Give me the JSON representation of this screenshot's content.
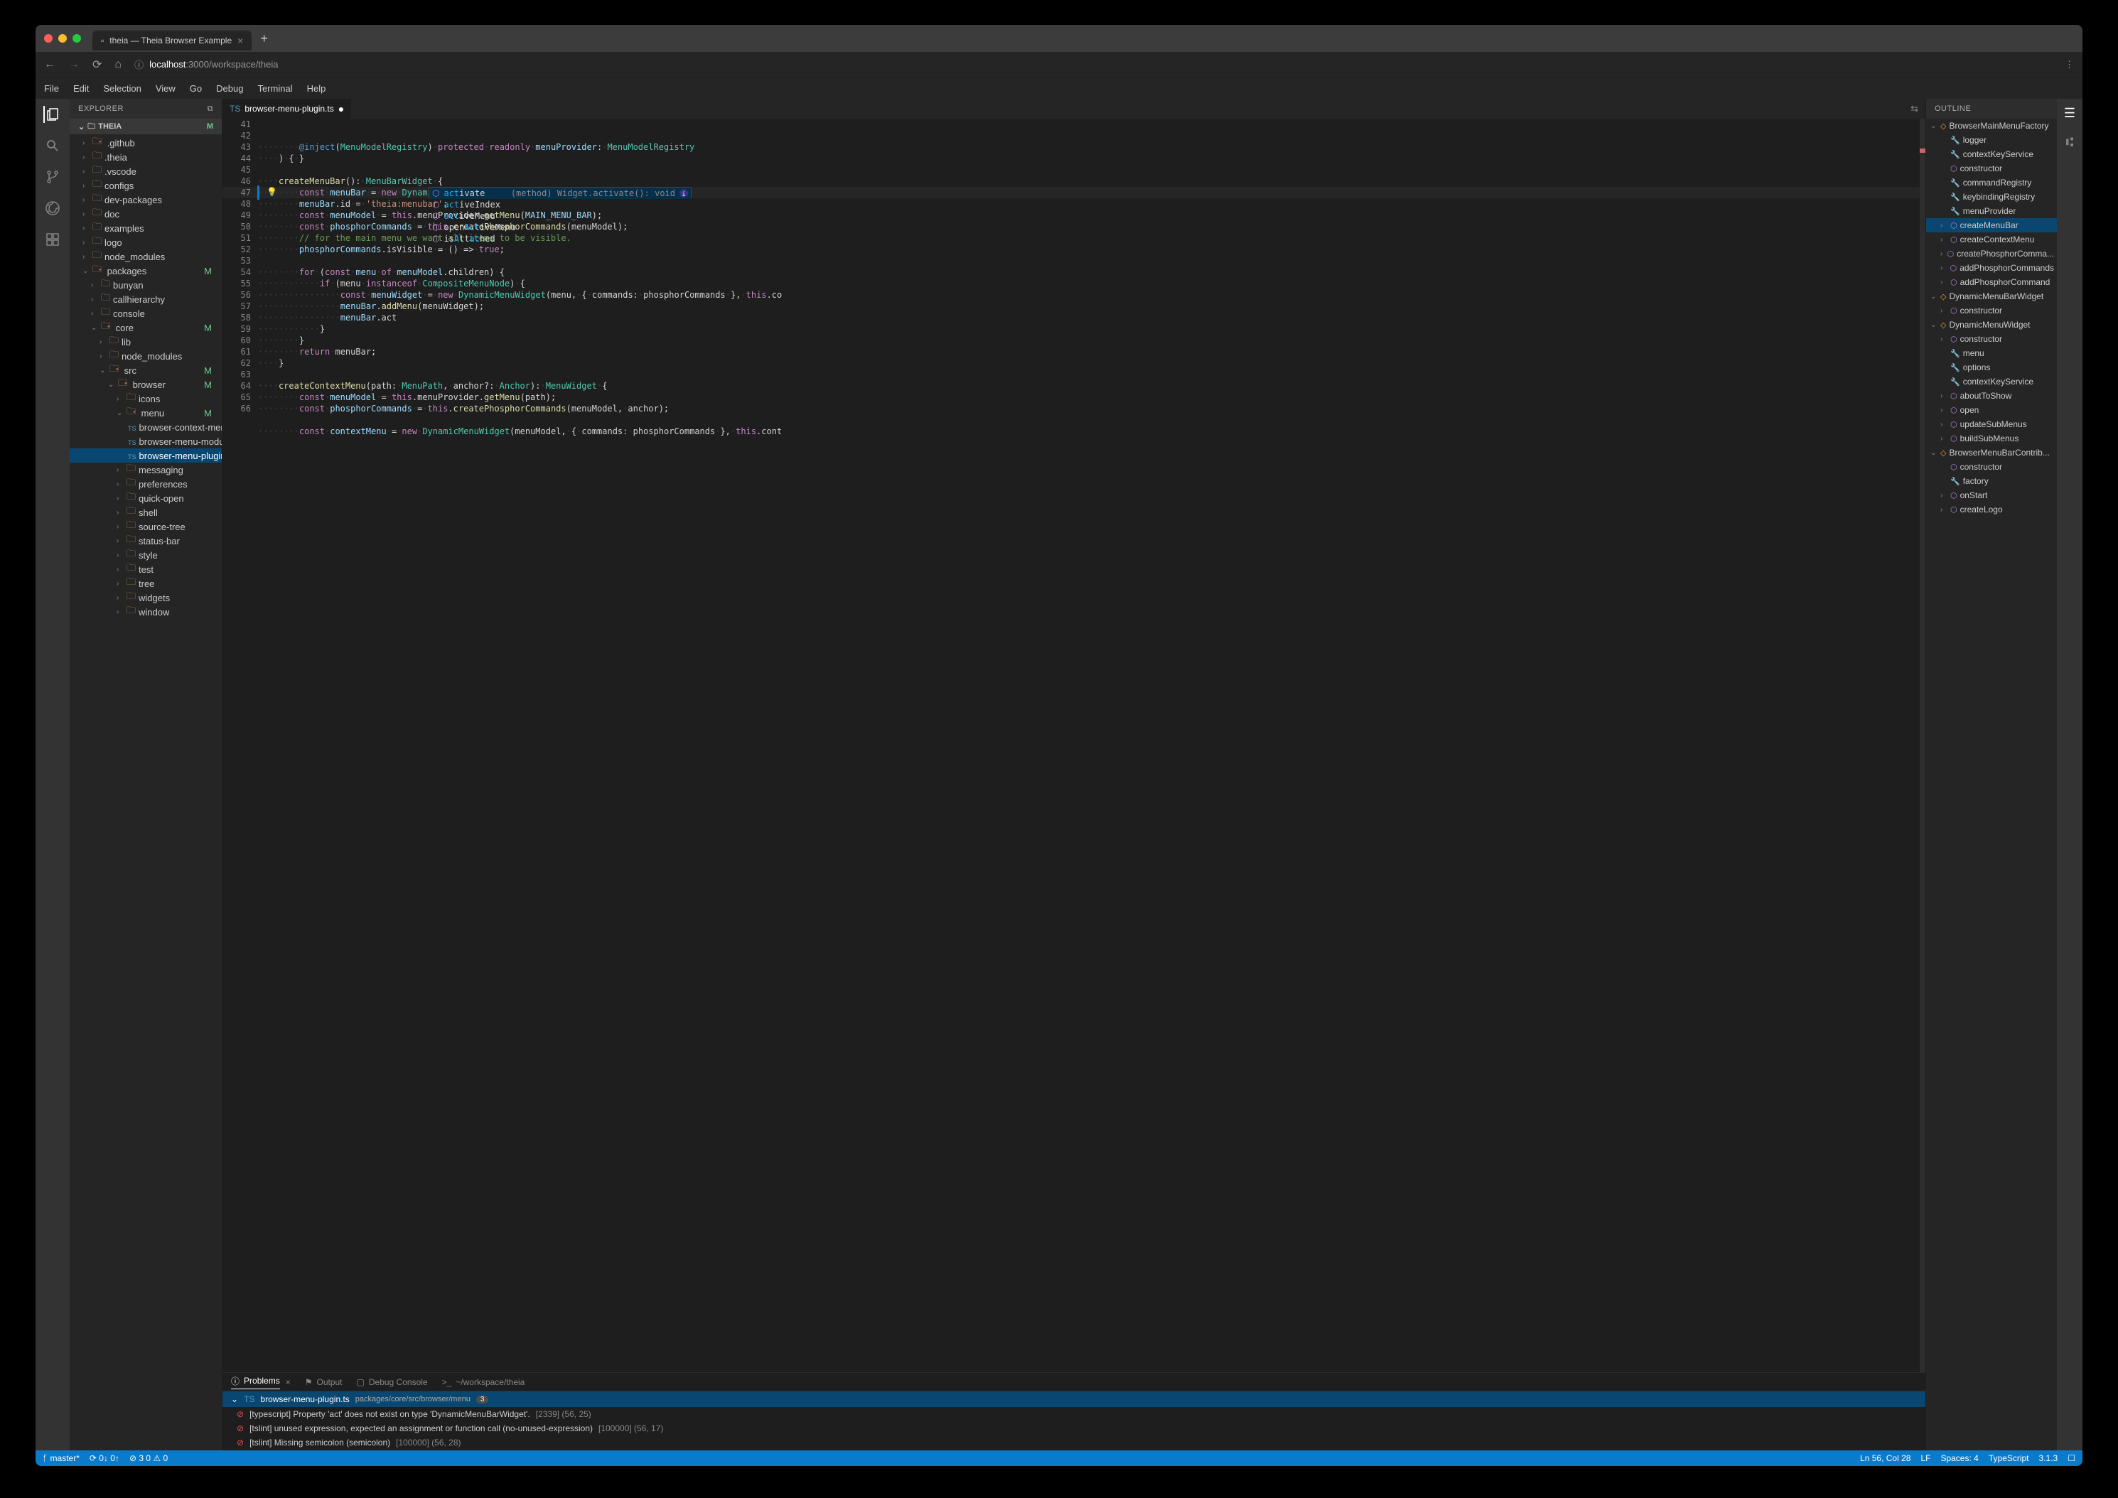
{
  "browser": {
    "tabTitle": "theia — Theia Browser Example",
    "host": "localhost",
    "port": ":3000",
    "path": "/workspace/theia"
  },
  "menubar": [
    "File",
    "Edit",
    "Selection",
    "View",
    "Go",
    "Debug",
    "Terminal",
    "Help"
  ],
  "explorer": {
    "title": "EXPLORER",
    "root": "THEIA",
    "rootMark": "M",
    "items": [
      {
        "d": 1,
        "k": "fdirty",
        "c": "r",
        "n": ".github"
      },
      {
        "d": 1,
        "k": "f",
        "c": "r",
        "n": ".theia"
      },
      {
        "d": 1,
        "k": "f",
        "c": "r",
        "n": ".vscode"
      },
      {
        "d": 1,
        "k": "f",
        "c": "r",
        "n": "configs"
      },
      {
        "d": 1,
        "k": "f",
        "c": "r",
        "n": "dev-packages"
      },
      {
        "d": 1,
        "k": "f",
        "c": "r",
        "n": "doc"
      },
      {
        "d": 1,
        "k": "f",
        "c": "r",
        "n": "examples"
      },
      {
        "d": 1,
        "k": "f",
        "c": "r",
        "n": "logo"
      },
      {
        "d": 1,
        "k": "f",
        "c": "r",
        "n": "node_modules"
      },
      {
        "d": 1,
        "k": "fdirty",
        "c": "d",
        "n": "packages",
        "m": "M"
      },
      {
        "d": 2,
        "k": "f",
        "c": "r",
        "n": "bunyan"
      },
      {
        "d": 2,
        "k": "f",
        "c": "r",
        "n": "callhierarchy"
      },
      {
        "d": 2,
        "k": "f",
        "c": "r",
        "n": "console"
      },
      {
        "d": 2,
        "k": "fdirty",
        "c": "d",
        "n": "core",
        "m": "M"
      },
      {
        "d": 3,
        "k": "f",
        "c": "r",
        "n": "lib"
      },
      {
        "d": 3,
        "k": "f",
        "c": "r",
        "n": "node_modules"
      },
      {
        "d": 3,
        "k": "fdirty",
        "c": "d",
        "n": "src",
        "m": "M"
      },
      {
        "d": 4,
        "k": "fdirty",
        "c": "d",
        "n": "browser",
        "m": "M"
      },
      {
        "d": 5,
        "k": "f",
        "c": "r",
        "n": "icons"
      },
      {
        "d": 5,
        "k": "fdirty",
        "c": "d",
        "n": "menu",
        "m": "M"
      },
      {
        "d": 6,
        "k": "file",
        "c": "",
        "n": "browser-context-menu-r..."
      },
      {
        "d": 6,
        "k": "file",
        "c": "",
        "n": "browser-menu-module.ts"
      },
      {
        "d": 6,
        "k": "file",
        "c": "",
        "n": "browser-menu-plugin.ts",
        "m": "M",
        "sel": true
      },
      {
        "d": 5,
        "k": "f",
        "c": "r",
        "n": "messaging"
      },
      {
        "d": 5,
        "k": "f",
        "c": "r",
        "n": "preferences"
      },
      {
        "d": 5,
        "k": "f",
        "c": "r",
        "n": "quick-open"
      },
      {
        "d": 5,
        "k": "f",
        "c": "r",
        "n": "shell"
      },
      {
        "d": 5,
        "k": "f",
        "c": "r",
        "n": "source-tree"
      },
      {
        "d": 5,
        "k": "f",
        "c": "r",
        "n": "status-bar"
      },
      {
        "d": 5,
        "k": "f",
        "c": "r",
        "n": "style"
      },
      {
        "d": 5,
        "k": "f",
        "c": "r",
        "n": "test"
      },
      {
        "d": 5,
        "k": "f",
        "c": "r",
        "n": "tree"
      },
      {
        "d": 5,
        "k": "f",
        "c": "r",
        "n": "widgets"
      },
      {
        "d": 5,
        "k": "f",
        "c": "r",
        "n": "window"
      }
    ]
  },
  "editor": {
    "tab": "browser-menu-plugin.ts",
    "startLine": 41,
    "code": [
      "········<span class='decor'>@inject</span>(<span class='ty'>MenuModelRegistry</span>)·<span class='kw'>protected</span>·<span class='kw'>readonly</span>·<span class='pa'>menuProvider</span>:·<span class='ty'>MenuModelRegistry</span>",
      "····)·{·}",
      "",
      "····<span class='fn'>createMenuBar</span>():·<span class='ty'>MenuBarWidget</span>·{",
      "········<span class='kw'>const</span>·<span class='pa'>menuBar</span>·=·<span class='kw'>new</span>·<span class='ty'>DynamicMenuBarWidget</span>();",
      "········<span class='pa'>menuBar</span>.id·=·<span class='st'>'theia:menubar'</span>;",
      "········<span class='kw'>const</span>·<span class='pa'>menuModel</span>·=·<span class='kw'>this</span>.menuProvider.<span class='fn'>getMenu</span>(<span class='pa'>MAIN_MENU_BAR</span>);",
      "········<span class='kw'>const</span>·<span class='pa'>phosphorCommands</span>·=·<span class='kw'>this</span>.<span class='fn'>createPhosphorCommands</span>(menuModel);",
      "········<span class='cm'>// for the main menu we want all items to be visible.</span>",
      "········<span class='pa'>phosphorCommands</span>.isVisible·=·()·=>·<span class='kw'>true</span>;",
      "",
      "········<span class='kw'>for</span>·(<span class='kw'>const</span>·<span class='pa'>menu</span>·<span class='kw'>of</span>·<span class='pa'>menuModel</span>.children)·{",
      "············<span class='kw'>if</span>·(menu·<span class='kw'>instanceof</span>·<span class='ty'>CompositeMenuNode</span>)·{",
      "················<span class='kw'>const</span>·<span class='pa'>menuWidget</span>·=·<span class='kw'>new</span>·<span class='ty'>DynamicMenuWidget</span>(menu,·{·commands:·phosphorCommands·},·<span class='kw'>this</span>.co",
      "················<span class='pa'>menuBar</span>.<span class='fn'>addMenu</span>(menuWidget);",
      "················<span class='pa'>menuBar</span>.act",
      "············}",
      "········}",
      "········<span class='kw'>return</span>·menuBar;",
      "····}",
      "",
      "····<span class='fn'>createContextMenu</span>(path:·<span class='ty'>MenuPath</span>,·anchor?:·<span class='ty'>Anchor</span>):·<span class='ty'>MenuWidget</span>·{",
      "········<span class='kw'>const</span>·<span class='pa'>menuModel</span>·=·<span class='kw'>this</span>.menuProvider.<span class='fn'>getMenu</span>(path);",
      "········<span class='kw'>const</span>·<span class='pa'>phosphorCommands</span>·=·<span class='kw'>this</span>.<span class='fn'>createPhosphorCommands</span>(menuModel,·anchor);",
      "",
      "········<span class='kw'>const</span>·<span class='pa'>contextMenu</span>·=·<span class='kw'>new</span>·<span class='ty'>DynamicMenuWidget</span>(menuModel,·{·commands:·phosphorCommands·},·<span class='kw'>this</span>.cont"
    ]
  },
  "suggest": {
    "items": [
      {
        "icon": "⬡",
        "text": "activate",
        "hl": "act",
        "detail": "(method) Widget.activate(): void",
        "sel": true,
        "info": true
      },
      {
        "icon": "⬡",
        "text": "activeIndex",
        "hl": "act"
      },
      {
        "icon": "⬡",
        "text": "activeMenu",
        "hl": "act"
      },
      {
        "icon": "⬡",
        "text": "openActiveMenu",
        "hl": "Act",
        "pre": "open"
      },
      {
        "icon": "⬡",
        "text": "isAttached",
        "hl": "A",
        "mid": "tt",
        "hl2": "ac",
        "post": "hed",
        "pre": "is"
      }
    ]
  },
  "panel": {
    "tabs": [
      {
        "icon": "ⓘ",
        "label": "Problems",
        "active": true,
        "closable": true
      },
      {
        "icon": "⚑",
        "label": "Output"
      },
      {
        "icon": "▢",
        "label": "Debug Console"
      },
      {
        "icon": ">_",
        "label": "~/workspace/theia"
      }
    ],
    "problemFile": {
      "name": "browser-menu-plugin.ts",
      "path": "packages/core/src/browser/menu",
      "count": "3"
    },
    "problems": [
      {
        "src": "[typescript]",
        "msg": "Property 'act' does not exist on type 'DynamicMenuBarWidget'.",
        "code": "[2339]",
        "loc": "(56, 25)"
      },
      {
        "src": "[tslint]",
        "msg": "unused expression, expected an assignment or function call (no-unused-expression)",
        "code": "[100000]",
        "loc": "(56, 17)"
      },
      {
        "src": "[tslint]",
        "msg": "Missing semicolon (semicolon)",
        "code": "[100000]",
        "loc": "(56, 28)"
      }
    ]
  },
  "outline": {
    "title": "OUTLINE",
    "items": [
      {
        "d": 0,
        "c": "d",
        "s": "class",
        "n": "BrowserMainMenuFactory"
      },
      {
        "d": 1,
        "c": "",
        "s": "field",
        "n": "logger"
      },
      {
        "d": 1,
        "c": "",
        "s": "field",
        "n": "contextKeyService"
      },
      {
        "d": 1,
        "c": "",
        "s": "method",
        "n": "constructor"
      },
      {
        "d": 1,
        "c": "",
        "s": "field",
        "n": "commandRegistry"
      },
      {
        "d": 1,
        "c": "",
        "s": "field",
        "n": "keybindingRegistry"
      },
      {
        "d": 1,
        "c": "",
        "s": "field",
        "n": "menuProvider"
      },
      {
        "d": 1,
        "c": "r",
        "s": "method",
        "n": "createMenuBar",
        "sel": true
      },
      {
        "d": 1,
        "c": "r",
        "s": "method",
        "n": "createContextMenu"
      },
      {
        "d": 1,
        "c": "r",
        "s": "method",
        "n": "createPhosphorComma..."
      },
      {
        "d": 1,
        "c": "r",
        "s": "method",
        "n": "addPhosphorCommands"
      },
      {
        "d": 1,
        "c": "r",
        "s": "method",
        "n": "addPhosphorCommand"
      },
      {
        "d": 0,
        "c": "d",
        "s": "class",
        "n": "DynamicMenuBarWidget"
      },
      {
        "d": 1,
        "c": "r",
        "s": "method",
        "n": "constructor"
      },
      {
        "d": 0,
        "c": "d",
        "s": "class",
        "n": "DynamicMenuWidget"
      },
      {
        "d": 1,
        "c": "r",
        "s": "method",
        "n": "constructor"
      },
      {
        "d": 1,
        "c": "",
        "s": "field",
        "n": "menu"
      },
      {
        "d": 1,
        "c": "",
        "s": "field",
        "n": "options"
      },
      {
        "d": 1,
        "c": "",
        "s": "field",
        "n": "contextKeyService"
      },
      {
        "d": 1,
        "c": "r",
        "s": "method",
        "n": "aboutToShow"
      },
      {
        "d": 1,
        "c": "r",
        "s": "method",
        "n": "open"
      },
      {
        "d": 1,
        "c": "r",
        "s": "method",
        "n": "updateSubMenus"
      },
      {
        "d": 1,
        "c": "r",
        "s": "method",
        "n": "buildSubMenus"
      },
      {
        "d": 0,
        "c": "d",
        "s": "class",
        "n": "BrowserMenuBarContrib..."
      },
      {
        "d": 1,
        "c": "",
        "s": "method",
        "n": "constructor"
      },
      {
        "d": 1,
        "c": "",
        "s": "field",
        "n": "factory"
      },
      {
        "d": 1,
        "c": "r",
        "s": "method",
        "n": "onStart"
      },
      {
        "d": 1,
        "c": "r",
        "s": "method",
        "n": "createLogo"
      }
    ]
  },
  "statusbar": {
    "branch": "master*",
    "sync": "0↓ 0↑",
    "errWarn": "3  0",
    "lnCol": "Ln 56, Col 28",
    "eol": "LF",
    "spaces": "Spaces: 4",
    "lang": "TypeScript",
    "ver": "3.1.3"
  }
}
